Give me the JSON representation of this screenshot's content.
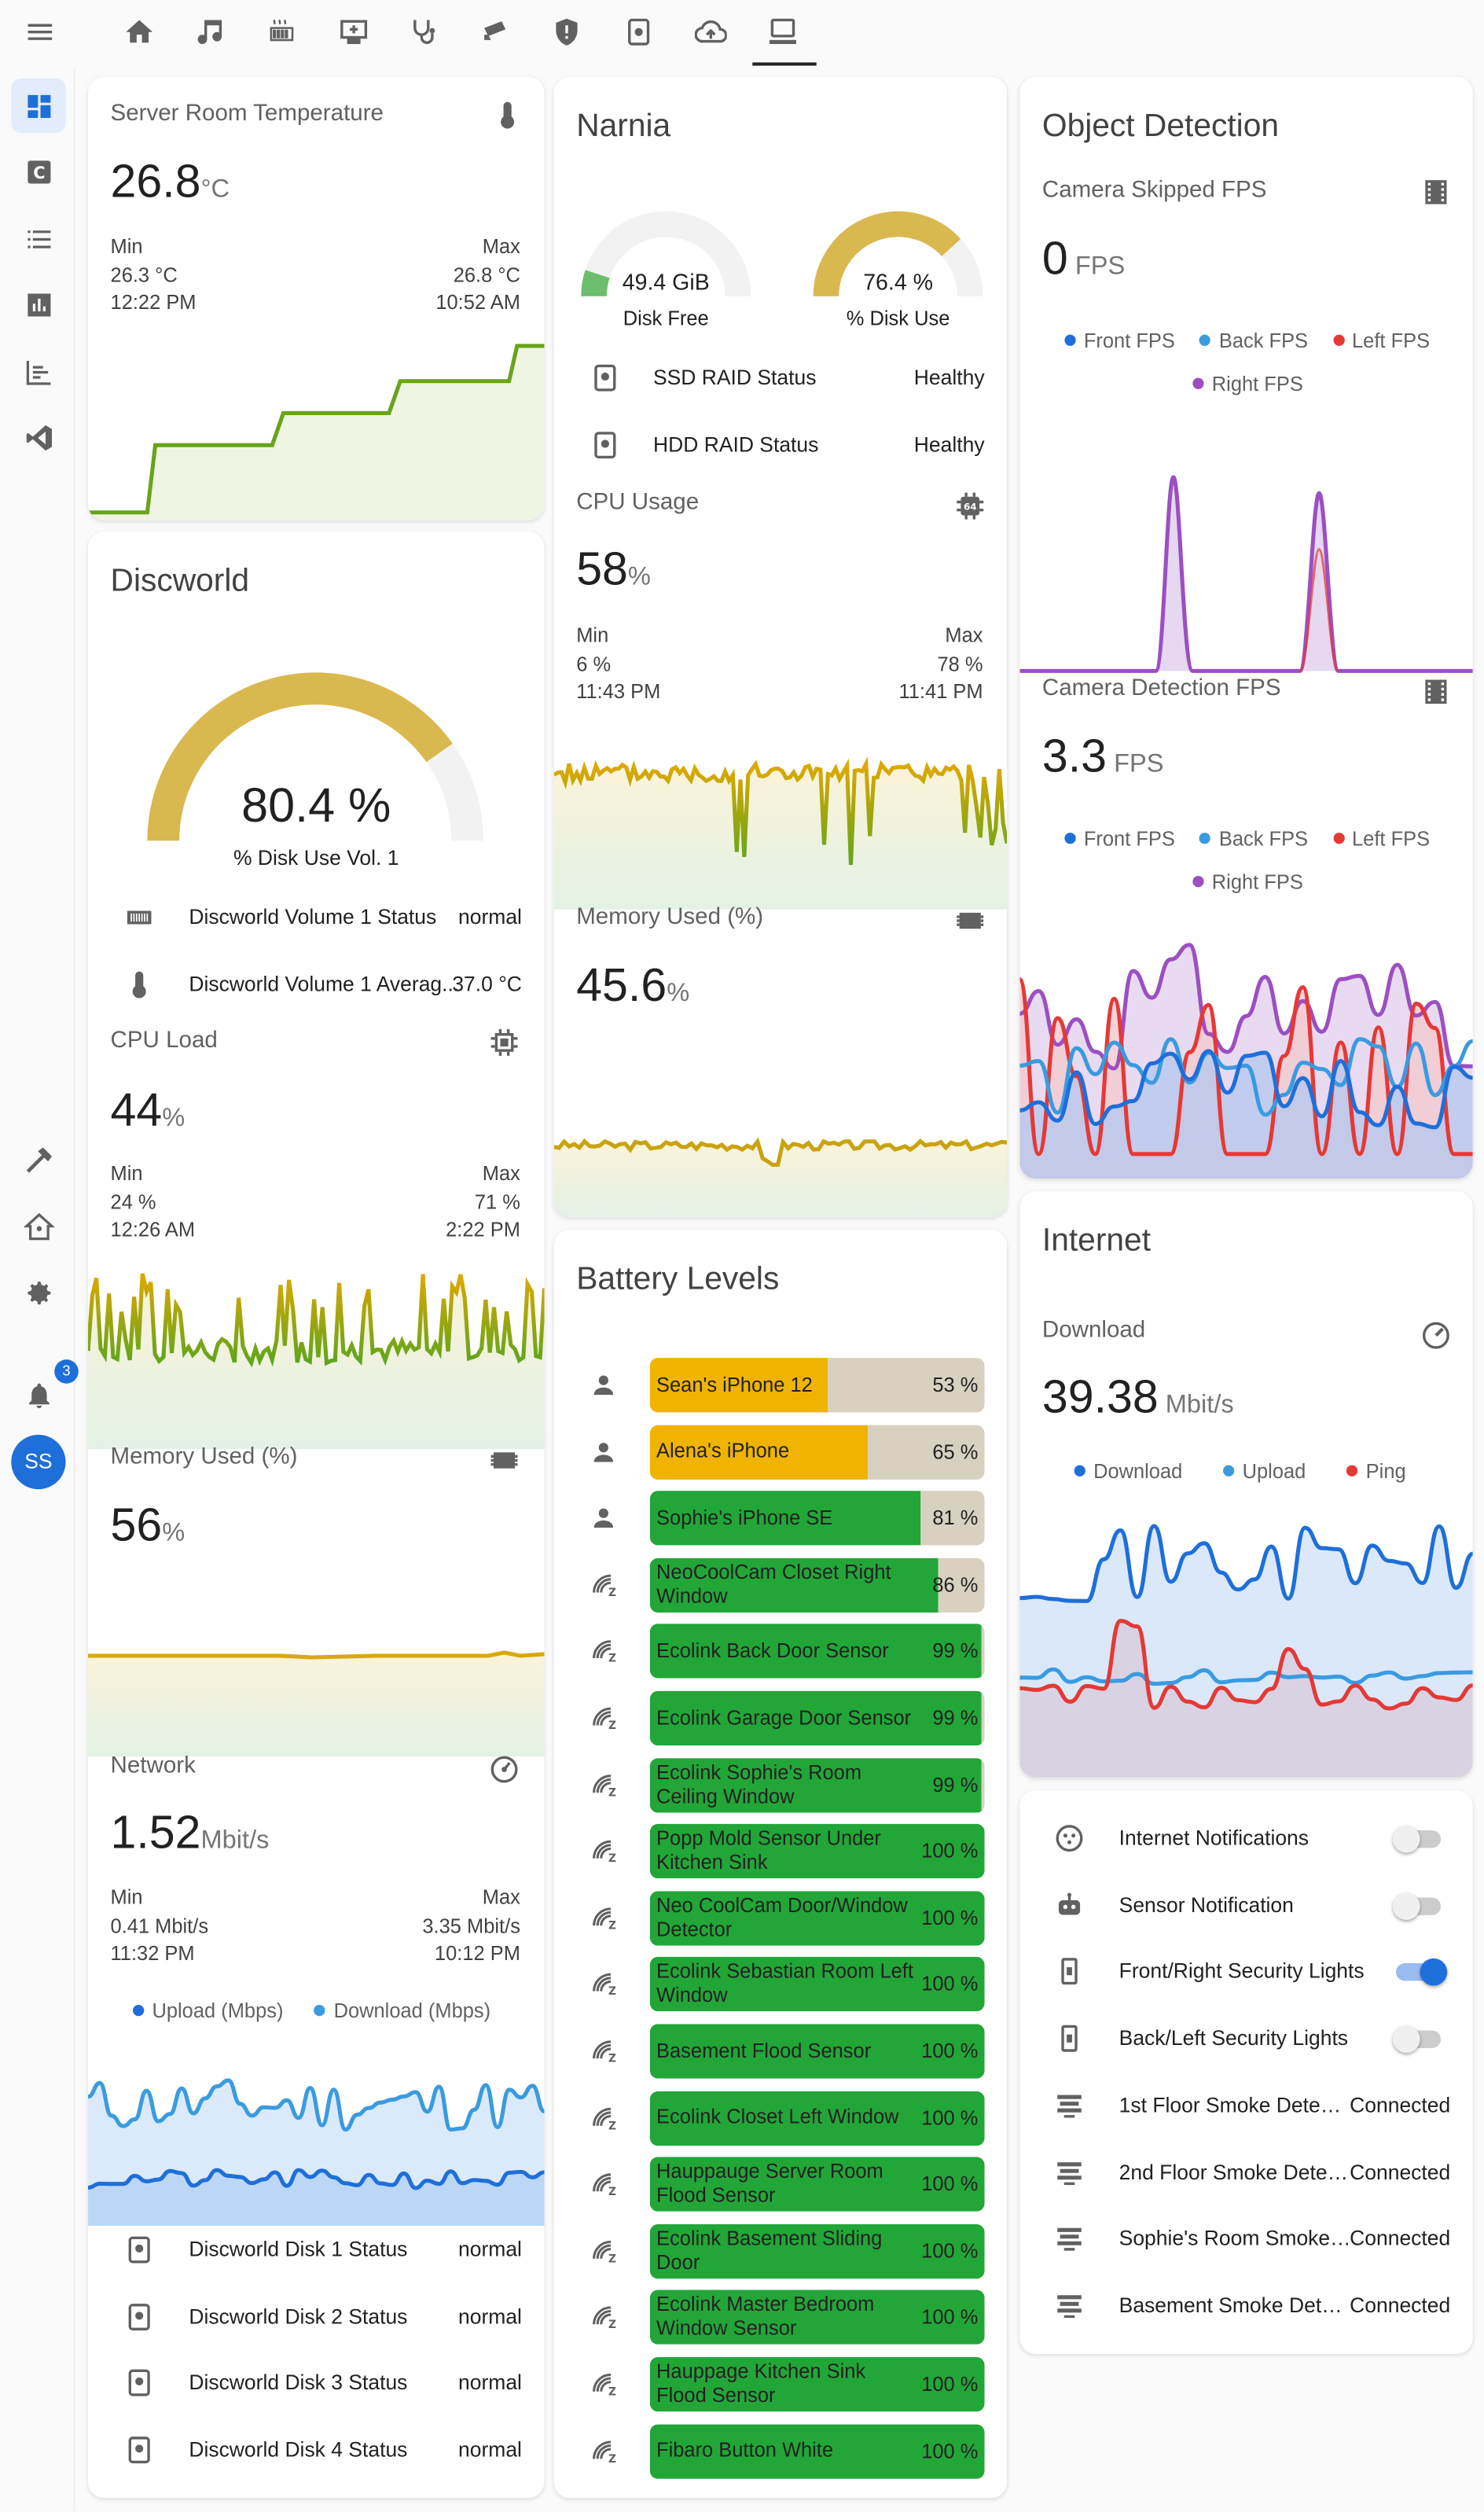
{
  "topbar": {
    "menu_icon": "menu-icon",
    "tabs": [
      "home-icon",
      "music-icon",
      "radiator-icon",
      "monitor-icon",
      "stethoscope-icon",
      "cctv-icon",
      "shield-icon",
      "nas-icon",
      "cloud-upload-icon",
      "server-icon"
    ]
  },
  "sidebar": {
    "items": [
      "dashboard-icon",
      "c-badge-icon",
      "list-icon",
      "bar-chart-icon",
      "timeline-icon",
      "vscode-icon"
    ],
    "bottom": [
      "hammer-icon",
      "home-assistant-icon",
      "gear-icon"
    ],
    "notifications": "3",
    "avatar": "SS"
  },
  "server_room": {
    "title": "Server Room Temperature",
    "value": "26.8",
    "unit": "°C",
    "min_label": "Min",
    "min_value": "26.3 °C",
    "min_time": "12:22 PM",
    "max_label": "Max",
    "max_value": "26.8 °C",
    "max_time": "10:52 AM",
    "line_color": "#7cb020"
  },
  "discworld": {
    "title": "Discworld",
    "gauge_value": "80.4 %",
    "gauge_fraction": 0.804,
    "gauge_label": "% Disk Use Vol. 1",
    "status_rows": [
      {
        "icon": "harddisk-icon",
        "label": "Discworld Volume 1 Status",
        "value": "normal"
      },
      {
        "icon": "thermometer-icon",
        "label": "Discworld Volume 1 Averag...",
        "value": "37.0 °C"
      }
    ],
    "cpu": {
      "title": "CPU Load",
      "value": "44",
      "unit": "%",
      "min_label": "Min",
      "min_value": "24 %",
      "min_time": "12:26 AM",
      "max_label": "Max",
      "max_value": "71 %",
      "max_time": "2:22 PM"
    },
    "memory": {
      "title": "Memory Used (%)",
      "value": "56",
      "unit": "%"
    },
    "network": {
      "title": "Network",
      "value": "1.52",
      "unit": "Mbit/s",
      "min_label": "Min",
      "min_value": "0.41 Mbit/s",
      "min_time": "11:32 PM",
      "max_label": "Max",
      "max_value": "3.35 Mbit/s",
      "max_time": "10:12 PM",
      "legend": [
        {
          "name": "Upload (Mbps)",
          "color": "#1e6fd9"
        },
        {
          "name": "Download (Mbps)",
          "color": "#3a9be0"
        }
      ]
    },
    "disks": [
      {
        "label": "Discworld Disk 1 Status",
        "value": "normal"
      },
      {
        "label": "Discworld Disk 2 Status",
        "value": "normal"
      },
      {
        "label": "Discworld Disk 3 Status",
        "value": "normal"
      },
      {
        "label": "Discworld Disk 4 Status",
        "value": "normal"
      }
    ]
  },
  "narnia": {
    "title": "Narnia",
    "gauges": [
      {
        "value": "49.4 GiB",
        "label": "Disk Free",
        "fraction": 0.1,
        "color": "#6cbd6c"
      },
      {
        "value": "76.4 %",
        "label": "% Disk Use",
        "fraction": 0.764,
        "color": "#d9b84f"
      }
    ],
    "status_rows": [
      {
        "label": "SSD RAID Status",
        "value": "Healthy"
      },
      {
        "label": "HDD RAID Status",
        "value": "Healthy"
      }
    ],
    "cpu": {
      "title": "CPU Usage",
      "value": "58",
      "unit": "%",
      "min_label": "Min",
      "min_value": "6 %",
      "min_time": "11:43 PM",
      "max_label": "Max",
      "max_value": "78 %",
      "max_time": "11:41 PM"
    },
    "memory": {
      "title": "Memory Used (%)",
      "value": "45.6",
      "unit": "%"
    }
  },
  "battery": {
    "title": "Battery Levels",
    "items": [
      {
        "label": "Sean's iPhone 12",
        "value": "53 %",
        "level": 0.53,
        "color": "#f0b400",
        "icon": "person"
      },
      {
        "label": "Alena's iPhone",
        "value": "65 %",
        "level": 0.65,
        "color": "#f0b400",
        "icon": "person"
      },
      {
        "label": "Sophie's iPhone SE",
        "value": "81 %",
        "level": 0.81,
        "color": "#22a638",
        "icon": "person"
      },
      {
        "label": "NeoCoolCam Closet Right Window",
        "value": "86 %",
        "level": 0.86,
        "color": "#22a638",
        "icon": "zwave"
      },
      {
        "label": "Ecolink Back Door Sensor",
        "value": "99 %",
        "level": 0.99,
        "color": "#22a638",
        "icon": "zwave"
      },
      {
        "label": "Ecolink Garage Door Sensor",
        "value": "99 %",
        "level": 0.99,
        "color": "#22a638",
        "icon": "zwave"
      },
      {
        "label": "Ecolink Sophie's Room Ceiling Window",
        "value": "99 %",
        "level": 0.99,
        "color": "#22a638",
        "icon": "zwave"
      },
      {
        "label": "Popp Mold Sensor Under Kitchen Sink",
        "value": "100 %",
        "level": 1,
        "color": "#22a638",
        "icon": "zwave"
      },
      {
        "label": "Neo CoolCam Door/Window Detector",
        "value": "100 %",
        "level": 1,
        "color": "#22a638",
        "icon": "zwave"
      },
      {
        "label": "Ecolink Sebastian Room Left Window",
        "value": "100 %",
        "level": 1,
        "color": "#22a638",
        "icon": "zwave"
      },
      {
        "label": "Basement Flood Sensor",
        "value": "100 %",
        "level": 1,
        "color": "#22a638",
        "icon": "zwave"
      },
      {
        "label": "Ecolink Closet Left Window",
        "value": "100 %",
        "level": 1,
        "color": "#22a638",
        "icon": "zwave"
      },
      {
        "label": "Hauppauge Server Room Flood Sensor",
        "value": "100 %",
        "level": 1,
        "color": "#22a638",
        "icon": "zwave"
      },
      {
        "label": "Ecolink Basement Sliding Door",
        "value": "100 %",
        "level": 1,
        "color": "#22a638",
        "icon": "zwave"
      },
      {
        "label": "Ecolink Master Bedroom Window Sensor",
        "value": "100 %",
        "level": 1,
        "color": "#22a638",
        "icon": "zwave"
      },
      {
        "label": "Hauppage Kitchen Sink Flood Sensor",
        "value": "100 %",
        "level": 1,
        "color": "#22a638",
        "icon": "zwave"
      },
      {
        "label": "Fibaro Button White",
        "value": "100 %",
        "level": 1,
        "color": "#22a638",
        "icon": "zwave"
      }
    ]
  },
  "object_detection": {
    "title": "Object Detection",
    "skipped": {
      "title": "Camera Skipped FPS",
      "value": "0",
      "unit": "FPS"
    },
    "detection": {
      "title": "Camera Detection FPS",
      "value": "3.3",
      "unit": "FPS"
    },
    "legend": [
      {
        "name": "Front FPS",
        "color": "#1e6fd9"
      },
      {
        "name": "Back FPS",
        "color": "#3a9be0"
      },
      {
        "name": "Left FPS",
        "color": "#e53935"
      },
      {
        "name": "Right FPS",
        "color": "#9c4fc2"
      }
    ]
  },
  "internet": {
    "title": "Internet",
    "download_title": "Download",
    "value": "39.38",
    "unit": "Mbit/s",
    "legend": [
      {
        "name": "Download",
        "color": "#1e6fd9"
      },
      {
        "name": "Upload",
        "color": "#3a9be0"
      },
      {
        "name": "Ping",
        "color": "#e53935"
      }
    ]
  },
  "controls": {
    "toggles": [
      {
        "label": "Internet Notifications",
        "on": false,
        "icon": "cookie-icon"
      },
      {
        "label": "Sensor Notification",
        "on": false,
        "icon": "robot-icon"
      },
      {
        "label": "Front/Right Security Lights",
        "on": true,
        "icon": "switch-icon"
      },
      {
        "label": "Back/Left Security Lights",
        "on": false,
        "icon": "switch-icon"
      }
    ],
    "smoke": [
      {
        "label": "1st Floor Smoke Detect...",
        "value": "Connected"
      },
      {
        "label": "2nd Floor Smoke Detect...",
        "value": "Connected"
      },
      {
        "label": "Sophie's Room Smoke ...",
        "value": "Connected"
      },
      {
        "label": "Basement Smoke Detec...",
        "value": "Connected"
      }
    ]
  }
}
